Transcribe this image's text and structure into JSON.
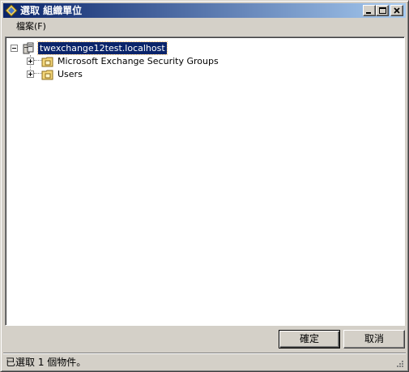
{
  "window": {
    "title": "選取 組織單位"
  },
  "menu": {
    "file_label": "檔案(F)"
  },
  "tree": {
    "root": {
      "label": "twexchange12test.localhost",
      "icon": "domain-icon",
      "expanded": true,
      "selected": true
    },
    "children": [
      {
        "label": "Microsoft Exchange Security Groups",
        "icon": "organizational-unit-folder-icon",
        "expanded": false
      },
      {
        "label": "Users",
        "icon": "organizational-unit-folder-icon",
        "expanded": false
      }
    ]
  },
  "buttons": {
    "ok_label": "確定",
    "cancel_label": "取消"
  },
  "status": {
    "text": "已選取 1 個物件。"
  },
  "colors": {
    "titlebar_start": "#0a246a",
    "titlebar_end": "#a6caf0",
    "selection": "#0a246a",
    "face": "#d4d0c8"
  }
}
